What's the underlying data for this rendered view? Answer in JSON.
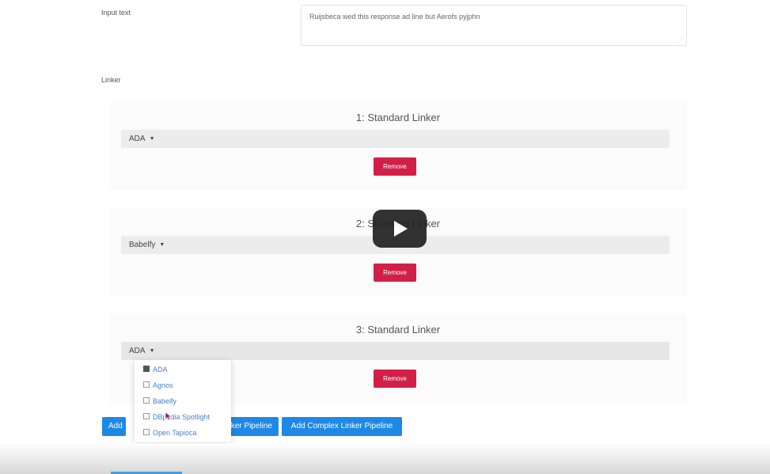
{
  "input_field": {
    "label": "Input text",
    "value": "Ruijsbeca wed this response ad line but Aerofs pyjphn"
  },
  "linker_label": "Linker",
  "cards": [
    {
      "title": "1: Standard Linker",
      "selected": "ADA",
      "remove_label": "Remove"
    },
    {
      "title": "2: Standard Linker",
      "selected": "Babelfy",
      "remove_label": "Remove"
    },
    {
      "title": "3: Standard Linker",
      "selected": "ADA",
      "remove_label": "Remove"
    }
  ],
  "dropdown_options": [
    {
      "label": "ADA",
      "checked": true
    },
    {
      "label": "Agnos",
      "checked": false
    },
    {
      "label": "Babelfy",
      "checked": false
    },
    {
      "label": "DBpedia Spotlight",
      "checked": false
    },
    {
      "label": "Open Tapioca",
      "checked": false
    }
  ],
  "buttons": {
    "add_short": "Add",
    "add_pipeline": "Add Linker Pipeline",
    "add_complex": "Add Complex Linker Pipeline"
  },
  "colors": {
    "remove": "#d21f47",
    "primary": "#1e88e5",
    "select_bar": "#ececec"
  },
  "icons": {
    "play": "play-icon",
    "caret": "chevron-down-icon",
    "cursor": "mouse-pointer-icon"
  }
}
